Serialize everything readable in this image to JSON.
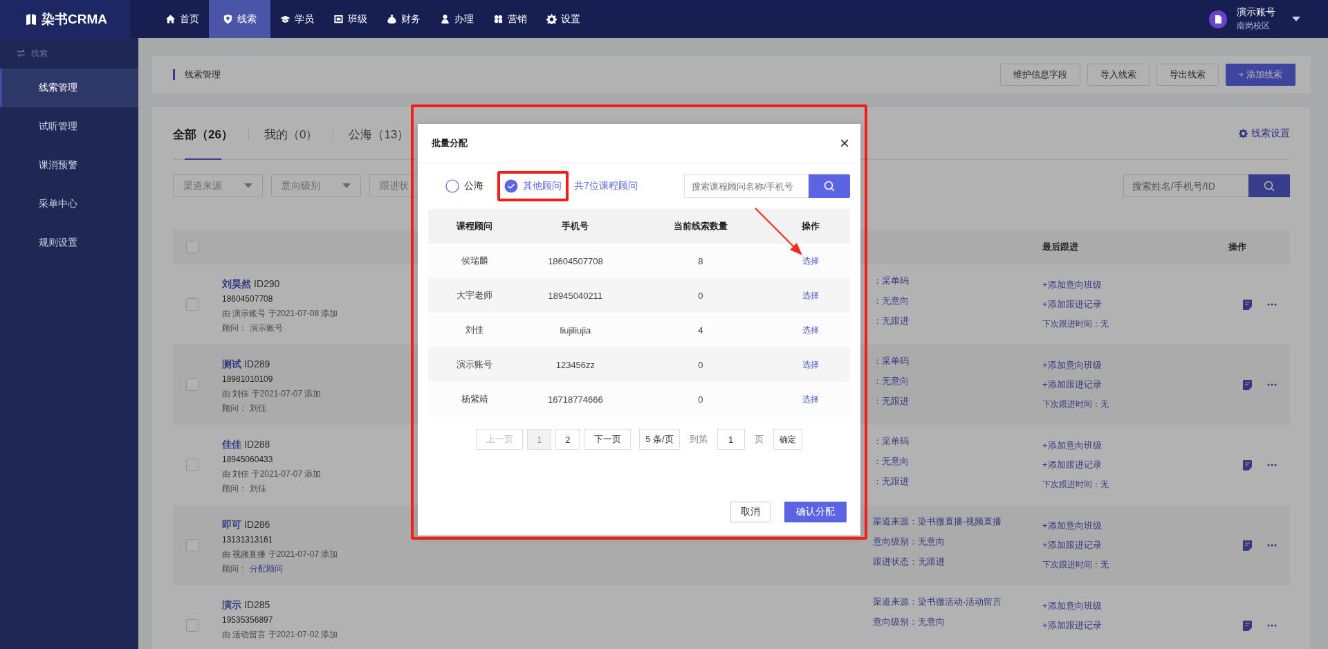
{
  "top_nav": {
    "logo": "染书CRMA",
    "items": [
      {
        "label": "首页",
        "selected": false
      },
      {
        "label": "线索",
        "selected": true
      },
      {
        "label": "学员",
        "selected": false
      },
      {
        "label": "班级",
        "selected": false
      },
      {
        "label": "财务",
        "selected": false
      },
      {
        "label": "办理",
        "selected": false
      },
      {
        "label": "营销",
        "selected": false
      },
      {
        "label": "设置",
        "selected": false
      }
    ],
    "user": {
      "name": "演示账号",
      "campus": "南岗校区"
    }
  },
  "sidebar": {
    "section": "线索",
    "items": [
      {
        "label": "线索管理",
        "selected": true
      },
      {
        "label": "试听管理",
        "selected": false
      },
      {
        "label": "课消预警",
        "selected": false
      },
      {
        "label": "采单中心",
        "selected": false
      },
      {
        "label": "规则设置",
        "selected": false
      }
    ]
  },
  "page_header": {
    "title": "线索管理",
    "buttons": [
      {
        "label": "维护信息字段",
        "kind": "default"
      },
      {
        "label": "导入线索",
        "kind": "default"
      },
      {
        "label": "导出线索",
        "kind": "default"
      },
      {
        "label": "+ 添加线索",
        "kind": "primary"
      }
    ]
  },
  "tabs": [
    {
      "label": "全部（26）",
      "selected": true
    },
    {
      "label": "我的（0）",
      "selected": false
    },
    {
      "label": "公海（13）",
      "selected": false
    }
  ],
  "settings_link": "线索设置",
  "filters": [
    {
      "placeholder": "渠道来源",
      "caret": true
    },
    {
      "placeholder": "意向级别",
      "caret": true
    },
    {
      "placeholder": "跟进状"
    }
  ],
  "search": {
    "placeholder": "搜索姓名/手机号/ID"
  },
  "table": {
    "header_checked": false,
    "columns": [
      {
        "label": "最后跟进"
      },
      {
        "label": "操作"
      }
    ],
    "rows": [
      {
        "checked": false,
        "name": "刘昊然",
        "id": "ID290",
        "phone": "18604507708",
        "added": "由 演示账号 于2021-07-08 添加",
        "advisor_label": "顾问：",
        "advisor": "演示账号",
        "advisor_link": false,
        "info": [
          "：采单码",
          "：无意向",
          "：无跟进"
        ],
        "follow": [
          {
            "text": "+添加意向班级",
            "kind": "link"
          },
          {
            "text": "+添加跟进记录",
            "kind": "link"
          },
          {
            "text": "下次跟进时间：无",
            "kind": "plain"
          }
        ]
      },
      {
        "checked": false,
        "name": "测试",
        "id": "ID289",
        "phone": "18981010109",
        "added": "由 刘佳 于2021-07-07 添加",
        "advisor_label": "顾问：",
        "advisor": "刘佳",
        "advisor_link": false,
        "info": [
          "：采单码",
          "：无意向",
          "：无跟进"
        ],
        "follow": [
          {
            "text": "+添加意向班级",
            "kind": "link"
          },
          {
            "text": "+添加跟进记录",
            "kind": "link"
          },
          {
            "text": "下次跟进时间：无",
            "kind": "plain"
          }
        ]
      },
      {
        "checked": false,
        "name": "佳佳",
        "id": "ID288",
        "phone": "18945060433",
        "added": "由 刘佳 于2021-07-07 添加",
        "advisor_label": "顾问：",
        "advisor": "刘佳",
        "advisor_link": false,
        "info": [
          "：采单码",
          "：无意向",
          "：无跟进"
        ],
        "follow": [
          {
            "text": "+添加意向班级",
            "kind": "link"
          },
          {
            "text": "+添加跟进记录",
            "kind": "link"
          },
          {
            "text": "下次跟进时间：无",
            "kind": "plain"
          }
        ]
      },
      {
        "checked": false,
        "name": "即可",
        "id": "ID286",
        "phone": "13131313161",
        "added": "由 视频直播 于2021-07-07 添加",
        "advisor_label": "顾问：",
        "advisor": "分配顾问",
        "advisor_link": true,
        "info": [
          "渠道来源：染书微直播-视频直播",
          "意向级别：无意向",
          "跟进状态：无跟进"
        ],
        "follow": [
          {
            "text": "+添加意向班级",
            "kind": "link"
          },
          {
            "text": "+添加跟进记录",
            "kind": "link"
          },
          {
            "text": "下次跟进时间：无",
            "kind": "plain"
          }
        ]
      },
      {
        "checked": false,
        "name": "演示",
        "id": "ID285",
        "phone": "19535356897",
        "added": "由 活动留言 于2021-07-02 添加",
        "info": [
          "渠道来源：染书微活动-活动留言",
          "意向级别：无意向"
        ],
        "follow": [
          {
            "text": "+添加意向班级",
            "kind": "link"
          },
          {
            "text": "+添加跟进记录",
            "kind": "link"
          }
        ]
      }
    ]
  },
  "dialog": {
    "title": "批量分配",
    "close": "×",
    "options": [
      {
        "label": "公海",
        "selected": false
      },
      {
        "label": "其他顾问",
        "selected": true
      }
    ],
    "count": "共7位课程顾问",
    "search": {
      "placeholder": "搜索课程顾问名称/手机号"
    },
    "columns": [
      "课程顾问",
      "手机号",
      "当前线索数量",
      "操作"
    ],
    "rows": [
      {
        "name": "侯瑞麟",
        "phone": "18604507708",
        "count": "8",
        "action": "选择"
      },
      {
        "name": "大宇老师",
        "phone": "18945040211",
        "count": "0",
        "action": "选择"
      },
      {
        "name": "刘佳",
        "phone": "liujiliujia",
        "count": "4",
        "action": "选择"
      },
      {
        "name": "演示账号",
        "phone": "123456zz",
        "count": "0",
        "action": "选择"
      },
      {
        "name": "杨紫靖",
        "phone": "16718774666",
        "count": "0",
        "action": "选择"
      }
    ],
    "pagination": {
      "prev": {
        "label": "上一页",
        "disabled": true
      },
      "pages": [
        {
          "label": "1",
          "selected": true
        },
        {
          "label": "2",
          "selected": false
        }
      ],
      "next": {
        "label": "下一页",
        "disabled": false
      },
      "page_size": "5 条/页",
      "goto_label": "到第",
      "goto_value": "1",
      "goto_unit": "页",
      "goto_button": "确定"
    },
    "buttons": [
      {
        "label": "取消",
        "kind": "default"
      },
      {
        "label": "确认分配",
        "kind": "primary"
      }
    ]
  }
}
